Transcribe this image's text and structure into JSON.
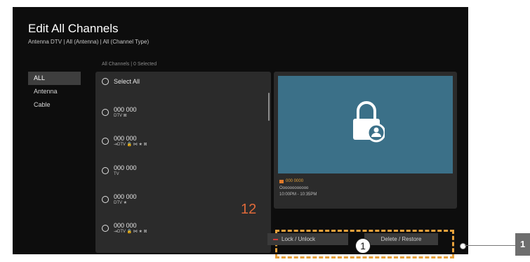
{
  "header": {
    "title": "Edit All Channels",
    "subtitle": "Antenna DTV | All (Antenna) | All (Channel Type)"
  },
  "list_header": "All Channels | 0 Selected",
  "sidebar": {
    "items": [
      {
        "label": "ALL",
        "active": true
      },
      {
        "label": "Antenna"
      },
      {
        "label": "Cable"
      }
    ]
  },
  "channel_list": {
    "select_all_label": "Select All",
    "channels": [
      {
        "number": "000 000",
        "type": "DTV ⊠"
      },
      {
        "number": "000 000",
        "type": "⇥DTV 🔒 ⋈ ★ ⊠"
      },
      {
        "number": "000 000",
        "type": "TV"
      },
      {
        "number": "000 000",
        "type": "DTV ★"
      },
      {
        "number": "000 000",
        "type": "⇥DTV 🔒 ⋈ ★ ⊠"
      }
    ]
  },
  "annotations": {
    "callout_number": "12",
    "marker_1": "1",
    "side_tag": "1",
    "accent_color": "#e8a23c"
  },
  "preview": {
    "icon": "lock-user-icon",
    "channel": "000 0000",
    "program_name": "Oooooooooooo",
    "time": "10:00PM - 10:35PM"
  },
  "buttons": {
    "lock_label": "Lock / Unlock",
    "delete_label": "Delete / Restore"
  }
}
